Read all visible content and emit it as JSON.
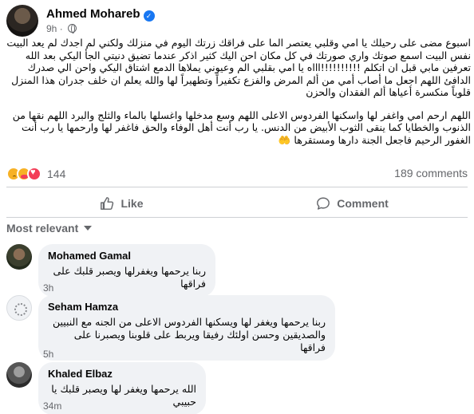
{
  "post": {
    "author": "Ahmed Mohareb",
    "verified_icon": "verified-badge-icon",
    "time": "9h",
    "separator": "·",
    "audience_icon": "globe-icon",
    "paragraphs": [
      "اسبوع مضى على رحيلك يا امي وقلبي يعتصر الما على فراقك زرتك اليوم في منزلك ولكني لم اجدك لم يعد البيت نفس البيت اسمع صوتك واري صورتك في كل مكان احن اليك كثير اذكر عندما تضيق دنيتي الجأ اليكي بعد الله تعرفين مابي قبل ان اتكلم !!!!!!!!!!اااه يا امي بقلبي الم وعيوني يملاها الدمع اشتاق اليكي واحن الي صدرك الدافئ اللهم اجعل ما أصاب أمي من ألم المرض والفزع تكفيراً وتطهيراً لها والله يعلم ان خلف جدران هذا المنزل قلوباً منكسرة أعياها ألم الفقدان والحزن",
      "اللهم ارحم امي واغفر لها واسكنها الفردوس الاعلى اللهم وسع مدخلها واغسلها بالماء والثلج والبرد اللهم نقها من الذنوب والخطايا كما ينقى الثوب الأبيض من الدنس. يا رب أنت أهل الوفاء والحق فاغفر لها وارحمها يا رب أنت الغفور الرحيم فاجعل الجنة دارها ومستقرها 🤲"
    ],
    "reaction_icons": [
      "sad-reaction-icon",
      "care-reaction-icon",
      "love-reaction-icon"
    ],
    "reaction_count": "144",
    "comment_count": "189 comments"
  },
  "actions": {
    "like_label": "Like",
    "comment_label": "Comment"
  },
  "sort": {
    "label": "Most relevant"
  },
  "comments": [
    {
      "name": "Mohamed Gamal",
      "text": "ربنا يرحمها ويغفرلها ويصبر قلبك على فراقها",
      "time": "3h"
    },
    {
      "name": "Seham Hamza",
      "text": "ربنا يرحمها ويغفر لها ويسكنها الفردوس الاعلى من الجنه مع النبيين والصديقين وحسن اولئك رفيقا ويربط على قلوبنا ويصبرنا على فراقها",
      "time": "5h"
    },
    {
      "name": "Khaled Elbaz",
      "text": "الله يرحمها ويغفر لها ويصبر قلبك يا حبيبي",
      "time": "34m"
    }
  ]
}
